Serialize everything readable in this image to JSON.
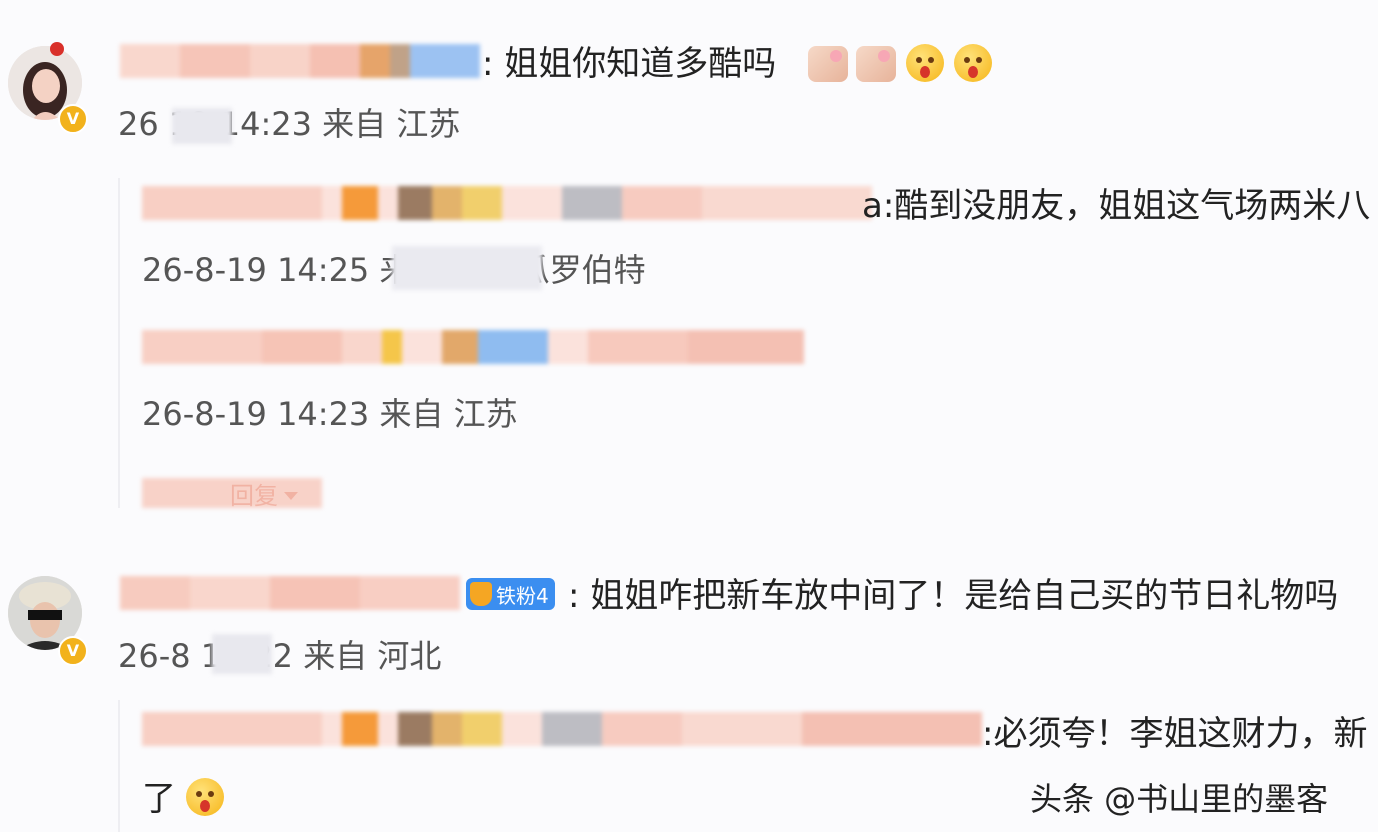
{
  "comments": [
    {
      "text": ": 姐姐你知道多酷吗",
      "meta": "26 19 14:23 来自 江苏",
      "verified_badge": "V",
      "replies": [
        {
          "text": "a:酷到没朋友，姐姐这气场两米八",
          "meta": "26-8-19 14:25 来 …村咚瓜罗伯特"
        },
        {
          "text": "",
          "meta": "26-8-19 14:23 来自 江苏"
        }
      ],
      "more_replies_label": "回复"
    },
    {
      "text": ": 姐姐咋把新车放中间了！是给自己买的节日礼物吗",
      "fan_badge": "铁粉4",
      "meta": "26-8 14:22 来自 河北",
      "verified_badge": "V",
      "replies": [
        {
          "text": ":必须夸！李姐这财力，新",
          "continuation": "了"
        }
      ]
    }
  ],
  "watermark": "头条 @书山里的墨客",
  "colors": {
    "verified": "#f2b21c",
    "fan_badge": "#3b8ef0",
    "blur_pink": "#f7c9bd"
  }
}
